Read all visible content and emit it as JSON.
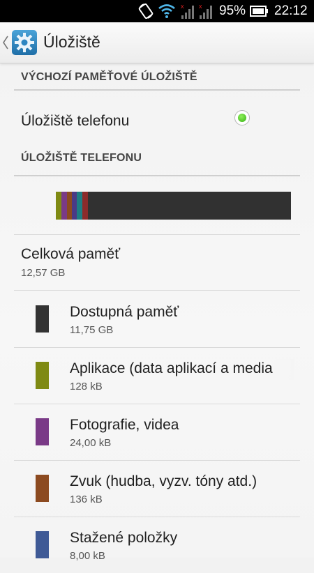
{
  "status_bar": {
    "battery_text": "95%",
    "time": "22:12",
    "icons": [
      "screen-rotation-icon",
      "wifi-icon",
      "signal-sim1-icon",
      "signal-sim2-icon",
      "battery-icon"
    ]
  },
  "header": {
    "title": "Úložiště",
    "icon": "settings-gear-icon"
  },
  "default_storage": {
    "section_title": "VÝCHOZÍ PAMĚŤOVÉ ÚLOŽIŠTĚ",
    "option_label": "Úložiště telefonu",
    "option_selected": true
  },
  "phone_storage": {
    "section_title": "ÚLOŽIŠTĚ TELEFONU",
    "total_label": "Celková paměť",
    "total_value": "12,57 GB",
    "categories": [
      {
        "label": "Dostupná paměť",
        "value": "11,75 GB",
        "color": "#333333"
      },
      {
        "label": "Aplikace (data aplikací a media",
        "value": "128 kB",
        "color": "#7f8a13"
      },
      {
        "label": "Fotografie, videa",
        "value": "24,00 kB",
        "color": "#7a3a87"
      },
      {
        "label": "Zvuk (hudba, vyzv. tóny atd.)",
        "value": "136 kB",
        "color": "#8c4a20"
      },
      {
        "label": "Stažené položky",
        "value": "8,00 kB",
        "color": "#3f5a96"
      }
    ],
    "usage_bar_colors": [
      "#7f8a13",
      "#7a3a87",
      "#8c4a20",
      "#4a3a86",
      "#1e7d82",
      "#8c2b2b",
      "#313131"
    ]
  }
}
